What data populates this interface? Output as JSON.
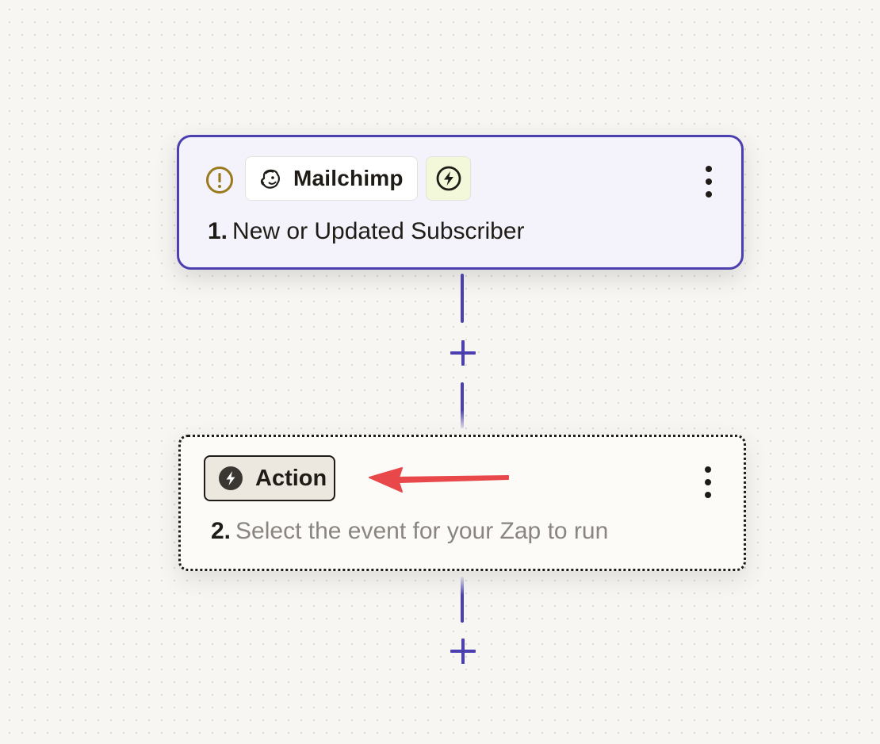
{
  "step1": {
    "app_name": "Mailchimp",
    "number": "1.",
    "title": "New or Updated Subscriber",
    "status_icon": "warning-icon",
    "type_icon": "trigger-bolt-icon"
  },
  "step2": {
    "chip_label": "Action",
    "number": "2.",
    "placeholder": "Select the event for your Zap to run"
  },
  "colors": {
    "accent": "#4c3fb0",
    "warning": "#9a7a1c",
    "canvas": "#f7f6f3",
    "annotation_arrow": "#e8484a"
  }
}
